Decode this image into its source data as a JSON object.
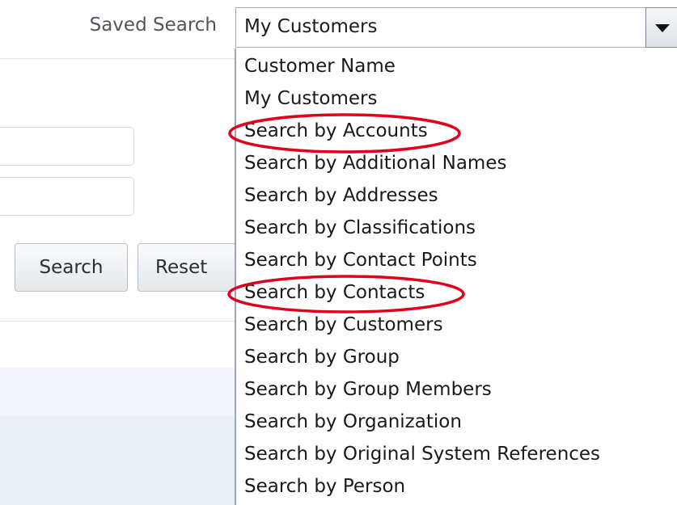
{
  "saved_search": {
    "label": "Saved Search",
    "selected_value": "My Customers"
  },
  "buttons": {
    "search": "Search",
    "reset": "Reset"
  },
  "dropdown": {
    "options": [
      "Customer Name",
      "My Customers",
      "Search by Accounts",
      "Search by Additional Names",
      "Search by Addresses",
      "Search by Classifications",
      "Search by Contact Points",
      "Search by Contacts",
      "Search by Customers",
      "Search by Group",
      "Search by Group Members",
      "Search by Organization",
      "Search by Original System References",
      "Search by Person"
    ],
    "highlighted": [
      "Search by Accounts",
      "Search by Contacts"
    ]
  },
  "colors": {
    "annotation": "#e0001b",
    "panel_light": "#f1f5f9",
    "panel_mid": "#e9eff5"
  }
}
